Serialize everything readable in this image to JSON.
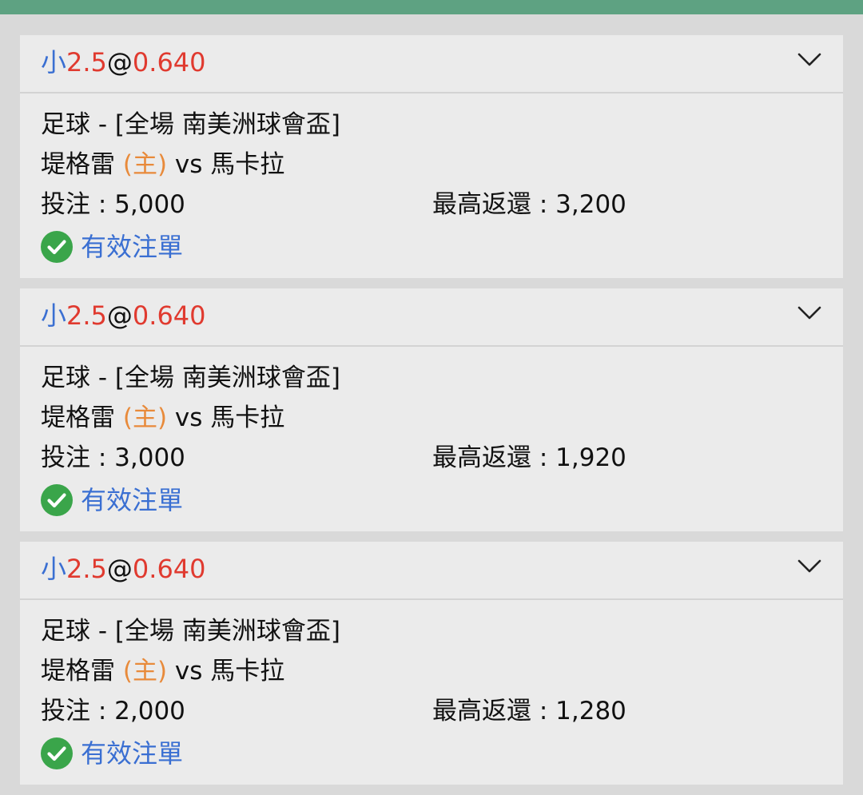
{
  "colors": {
    "top_bar": "#5ea282",
    "selection_word": "#3a6fd2",
    "selection_number": "#e03a2f",
    "at_sign": "#111111",
    "home_marker": "#e88a3a",
    "status_text": "#3a6fd2",
    "status_icon": "#3aa54a"
  },
  "icons": {
    "expand": "chevron-down-icon",
    "status": "check-circle-icon"
  },
  "bets": [
    {
      "selection": {
        "side": "小",
        "line": "2.5",
        "at": "@",
        "odds": "0.640"
      },
      "sport_league": "足球 - [全場 南美洲球會盃]",
      "home_team": "堤格雷",
      "home_marker": "(主)",
      "versus": "vs",
      "away_team": "馬卡拉",
      "stake_label": "投注 : ",
      "stake_value": "5,000",
      "max_return_label": "最高返還 : ",
      "max_return_value": "3,200",
      "status": "有效注單"
    },
    {
      "selection": {
        "side": "小",
        "line": "2.5",
        "at": "@",
        "odds": "0.640"
      },
      "sport_league": "足球 - [全場 南美洲球會盃]",
      "home_team": "堤格雷",
      "home_marker": "(主)",
      "versus": "vs",
      "away_team": "馬卡拉",
      "stake_label": "投注 : ",
      "stake_value": "3,000",
      "max_return_label": "最高返還 : ",
      "max_return_value": "1,920",
      "status": "有效注單"
    },
    {
      "selection": {
        "side": "小",
        "line": "2.5",
        "at": "@",
        "odds": "0.640"
      },
      "sport_league": "足球 - [全場 南美洲球會盃]",
      "home_team": "堤格雷",
      "home_marker": "(主)",
      "versus": "vs",
      "away_team": "馬卡拉",
      "stake_label": "投注 : ",
      "stake_value": "2,000",
      "max_return_label": "最高返還 : ",
      "max_return_value": "1,280",
      "status": "有效注單"
    }
  ]
}
